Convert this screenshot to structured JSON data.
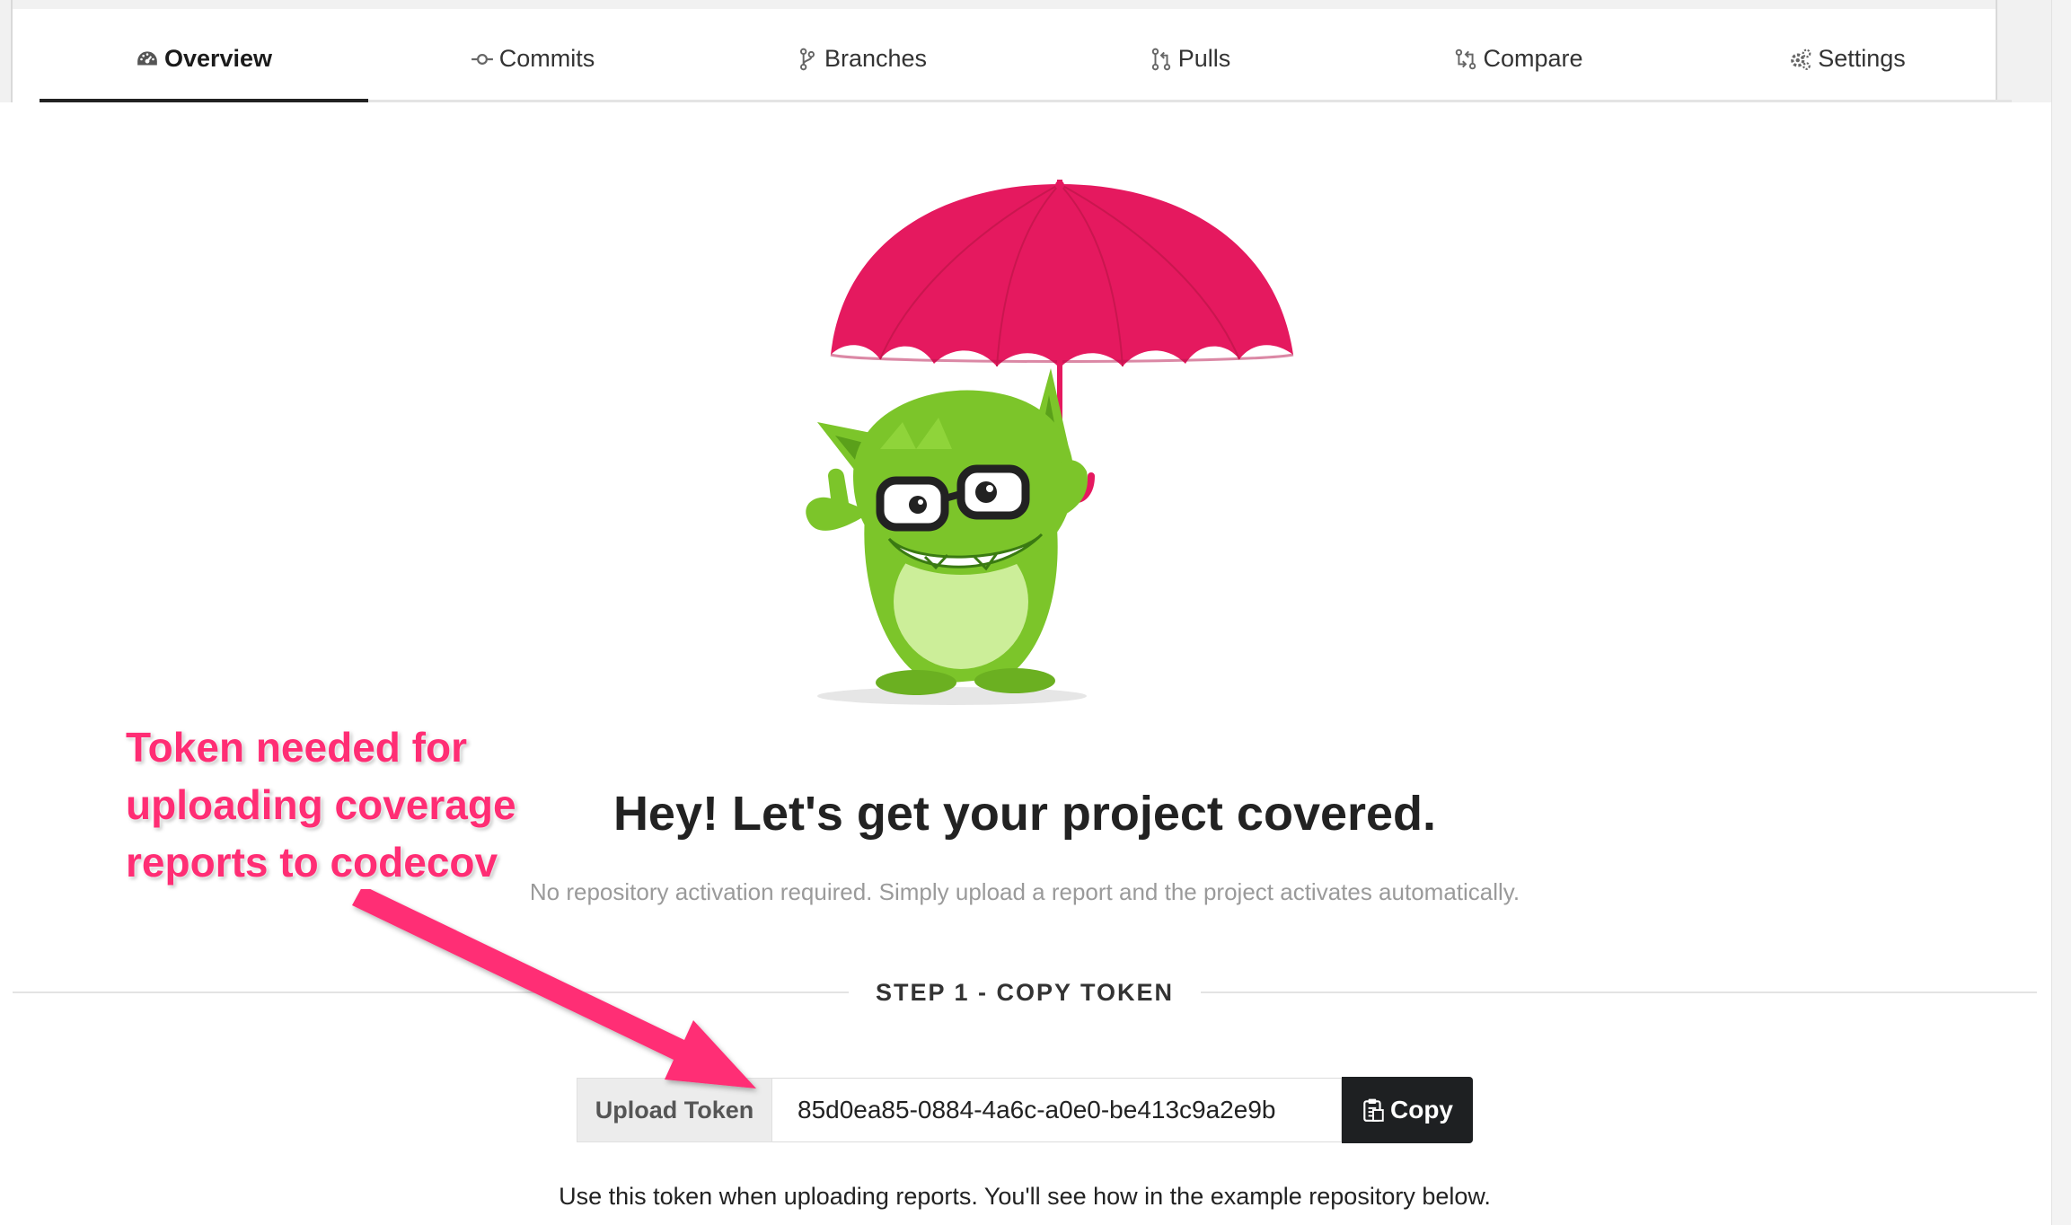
{
  "tabs": [
    {
      "label": "Overview",
      "icon": "dashboard-icon",
      "active": true
    },
    {
      "label": "Commits",
      "icon": "commit-icon",
      "active": false
    },
    {
      "label": "Branches",
      "icon": "branch-icon",
      "active": false
    },
    {
      "label": "Pulls",
      "icon": "pull-request-icon",
      "active": false
    },
    {
      "label": "Compare",
      "icon": "compare-icon",
      "active": false
    },
    {
      "label": "Settings",
      "icon": "gear-icon",
      "active": false
    }
  ],
  "hero": {
    "title": "Hey! Let's get your project covered.",
    "subtitle": "No repository activation required. Simply upload a report and the project activates automatically."
  },
  "step": {
    "label": "STEP 1 - COPY TOKEN"
  },
  "token": {
    "label": "Upload Token",
    "value": "85d0ea85-0884-4a6c-a0e0-be413c9a2e9b",
    "copy_label": "Copy",
    "helper": "Use this token when uploading reports. You'll see how in the example repository below."
  },
  "annotation": {
    "text_lines": [
      "Token needed for",
      "uploading coverage",
      "reports to codecov"
    ],
    "color": "#ff2d74"
  },
  "colors": {
    "accent_pink": "#e5195f",
    "mascot_green": "#7cc52a",
    "dark_button": "#1e2022"
  }
}
